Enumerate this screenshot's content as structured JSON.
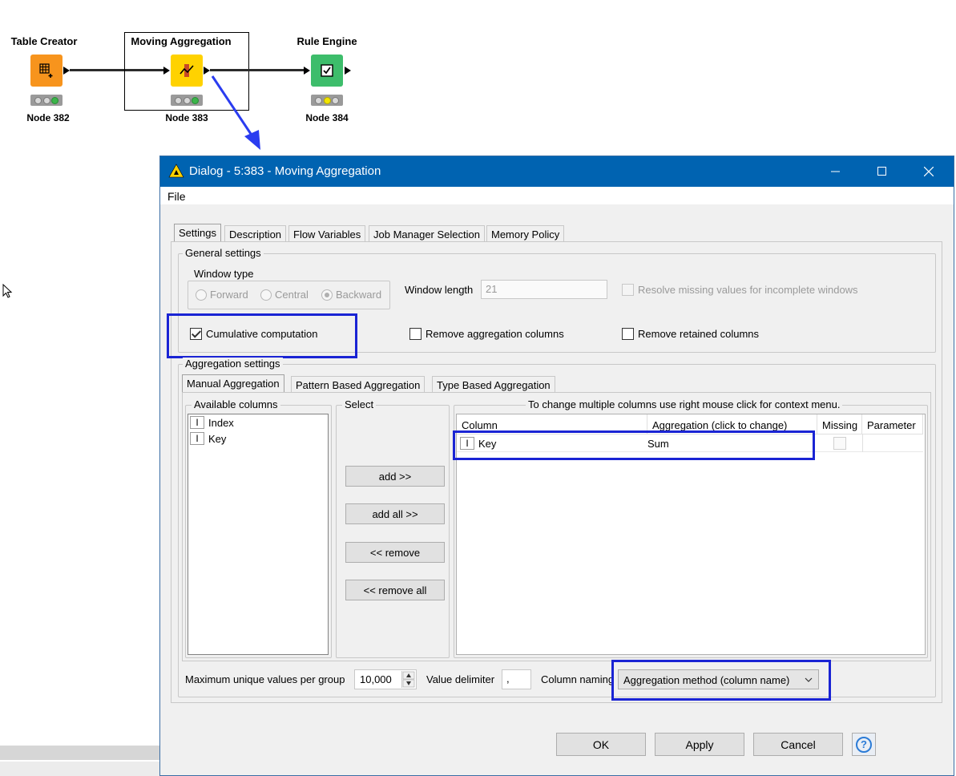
{
  "workflow": {
    "nodes": [
      {
        "title": "Table Creator",
        "label": "Node 382",
        "color": "#f7941d"
      },
      {
        "title": "Moving Aggregation",
        "label": "Node 383",
        "color": "#ffd200"
      },
      {
        "title": "Rule Engine",
        "label": "Node 384",
        "color": "#3dbd6b"
      }
    ]
  },
  "dialog": {
    "title": "Dialog - 5:383 - Moving Aggregation",
    "menu": {
      "file": "File"
    },
    "tabs": [
      "Settings",
      "Description",
      "Flow Variables",
      "Job Manager Selection",
      "Memory Policy"
    ],
    "general": {
      "legend": "General settings",
      "window_type_legend": "Window type",
      "window_types": [
        "Forward",
        "Central",
        "Backward"
      ],
      "selected_window_type": "Backward",
      "window_length_label": "Window length",
      "window_length_value": "21",
      "resolve_missing_label": "Resolve missing values for incomplete windows",
      "cumulative_label": "Cumulative computation",
      "remove_agg_label": "Remove aggregation columns",
      "remove_retained_label": "Remove retained columns"
    },
    "aggregation": {
      "legend": "Aggregation settings",
      "tabs": [
        "Manual Aggregation",
        "Pattern Based Aggregation",
        "Type Based Aggregation"
      ],
      "available_legend": "Available columns",
      "available_columns": [
        "Index",
        "Key"
      ],
      "column_type_glyph": "I",
      "select_legend": "Select",
      "buttons": {
        "add": "add >>",
        "add_all": "add all >>",
        "remove": "<< remove",
        "remove_all": "<< remove all"
      },
      "table_legend": "To change multiple columns use right mouse click for context menu.",
      "table_headers": [
        "Column",
        "Aggregation (click to change)",
        "Missing",
        "Parameter"
      ],
      "rows": [
        {
          "column": "Key",
          "aggregation": "Sum"
        }
      ]
    },
    "bottom": {
      "max_unique_label": "Maximum unique values per group",
      "max_unique_value": "10,000",
      "delimiter_label": "Value delimiter",
      "delimiter_value": ",",
      "column_naming_label": "Column naming",
      "column_naming_value": "Aggregation method (column name)"
    },
    "footer": {
      "ok": "OK",
      "apply": "Apply",
      "cancel": "Cancel",
      "help": "?"
    }
  },
  "colors": {
    "titlebar": "#0063b1",
    "highlight": "#1a24d4",
    "arrow": "#2a3cf0"
  }
}
